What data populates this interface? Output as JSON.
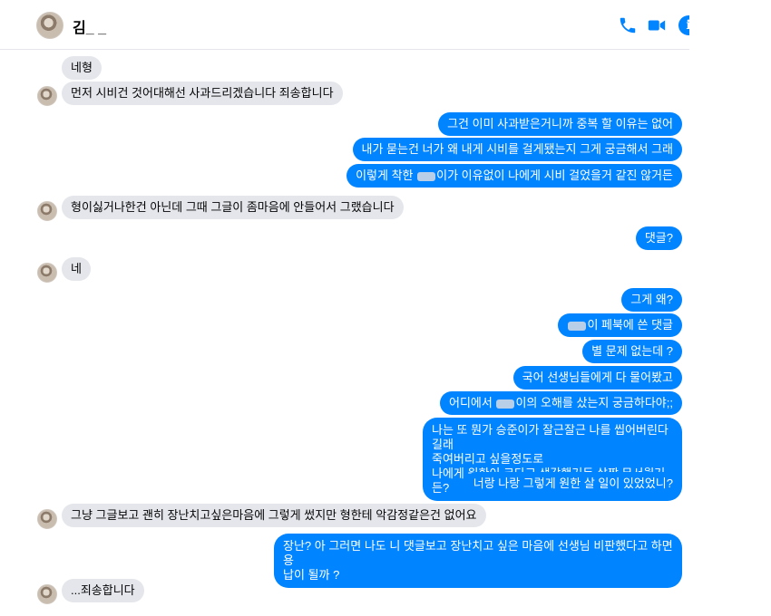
{
  "header": {
    "contact_name": "김_ _",
    "actions": [
      "phone-icon",
      "video-camera-icon",
      "info-icon"
    ]
  },
  "colors": {
    "accent": "#0084ff",
    "incoming_bubble": "#e4e6eb",
    "outgoing_text": "#ffffff"
  },
  "messages": [
    {
      "dir": "in",
      "text": "네형"
    },
    {
      "dir": "in",
      "text": "먼저 시비건 것어대해선 사과드리겠습니다 죄송합니다"
    },
    {
      "dir": "out",
      "text": "그건 이미 사과받은거니까 중복 할 이유는 없어"
    },
    {
      "dir": "out",
      "text": "내가 묻는건 너가 왜 내게 시비를 걸게됐는지 그게 궁금해서 그래"
    },
    {
      "dir": "out",
      "text_a": "이렇게 착한 ",
      "text_b": "이가 이유없이  나에게 시비 걸었을거 같진 않거든"
    },
    {
      "dir": "in",
      "text": "형이싫거나한건 아닌데 그때 그글이 좀마음에 안들어서 그랬습니다"
    },
    {
      "dir": "out",
      "text": "댓글?"
    },
    {
      "dir": "in",
      "text": "네"
    },
    {
      "dir": "out",
      "text": "그게 왜?"
    },
    {
      "dir": "out",
      "text_b": "이 페북에 쓴 댓글"
    },
    {
      "dir": "out",
      "text": "별 문제 없는데 ?"
    },
    {
      "dir": "out",
      "text": "국어 선생님들에게 다 물어봤고"
    },
    {
      "dir": "out",
      "text_a": "어디에서 ",
      "text_b": "이의 오해를 샀는지 궁금하다야;;"
    },
    {
      "dir": "out",
      "lines": [
        "나는 또 뭔가 승준이가 잘근잘근 나를 씹어버린다길래",
        "죽여버리고 싶을정도로",
        "나에게 원한이 크다고 생각했거든 살짝 무서웠거든?"
      ]
    },
    {
      "dir": "out",
      "text": "너랑 나랑 그렇게 원한 살 일이 있었었니?"
    },
    {
      "dir": "in",
      "text": "그냥 그글보고 괜히 장난치고싶은마음에 그렇게 썼지만 형한테 악감정같은건 없어요"
    },
    {
      "dir": "out",
      "lines": [
        "장난? 아 그러면 나도 니 댓글보고 장난치고 싶은 마음에 선생님 비판했다고 하면 용",
        "납이 될까 ?"
      ]
    },
    {
      "dir": "in",
      "text": "...죄송합니다"
    }
  ]
}
